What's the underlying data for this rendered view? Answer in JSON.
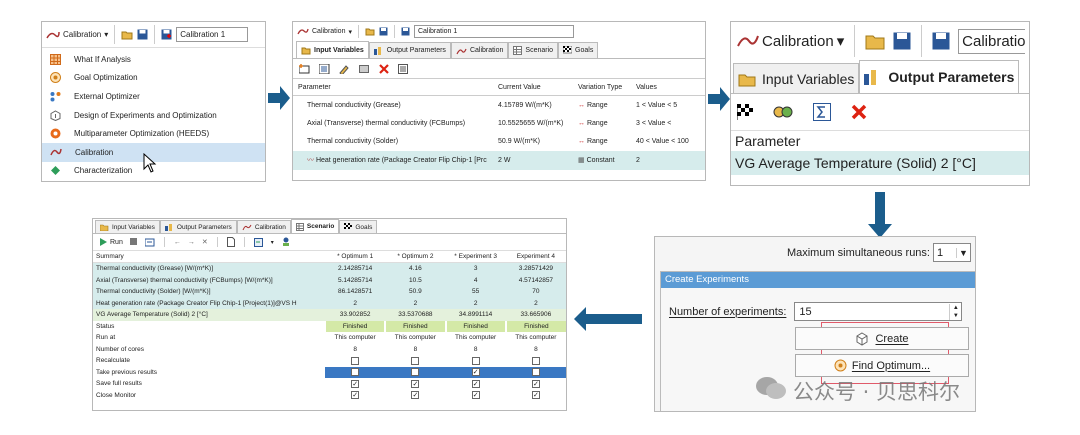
{
  "toolbar": {
    "calibration_label": "Calibration",
    "calibration_field": "Calibration 1"
  },
  "menu": {
    "items": [
      {
        "label": "What If Analysis",
        "icon": "grid-icon"
      },
      {
        "label": "Goal Optimization",
        "icon": "target-icon"
      },
      {
        "label": "External Optimizer",
        "icon": "nodes-icon"
      },
      {
        "label": "Design of Experiments and Optimization",
        "icon": "doe-icon"
      },
      {
        "label": "Multiparameter Optimization (HEEDS)",
        "icon": "heeds-icon"
      },
      {
        "label": "Calibration",
        "icon": "calibration-icon"
      },
      {
        "label": "Characterization",
        "icon": "characterization-icon"
      }
    ]
  },
  "tabs": {
    "input_variables": "Input Variables",
    "output_parameters": "Output Parameters",
    "calibration": "Calibration",
    "scenario": "Scenario",
    "goals": "Goals"
  },
  "variables_table": {
    "headers": [
      "Parameter",
      "Current Value",
      "Variation Type",
      "Values"
    ],
    "rows": [
      {
        "param": "Thermal conductivity (Grease)",
        "value": "4.15789 W/(m*K)",
        "type": "Range",
        "values": "1 < Value < 5"
      },
      {
        "param": "Axial (Transverse) thermal conductivity (FCBumps)",
        "value": "10.5525655 W/(m*K)",
        "type": "Range",
        "values": "3 < Value <"
      },
      {
        "param": "Thermal conductivity (Solder)",
        "value": "50.9 W/(m*K)",
        "type": "Range",
        "values": "40 < Value < 100"
      },
      {
        "param": "Heat generation rate (Package Creator Flip Chip-1 [Prc",
        "value": "2 W",
        "type": "Constant",
        "values": "2"
      }
    ]
  },
  "output_panel": {
    "header": "Parameter",
    "row": "VG Average Temperature (Solid) 2 [°C]"
  },
  "scenario_toolbar": {
    "run_label": "Run"
  },
  "scenario_table": {
    "headers": [
      "Summary",
      "* Optimum 1",
      "* Optimum 2",
      "* Experiment 3",
      "Experiment 4"
    ],
    "value_rows": [
      {
        "label": "Thermal conductivity (Grease) [W/(m*K)]",
        "vals": [
          "2.14285714",
          "4.16",
          "3",
          "3.28571429"
        ]
      },
      {
        "label": "Axial (Transverse) thermal conductivity (FCBumps) [W/(m*K)]",
        "vals": [
          "5.14285714",
          "10.5",
          "4",
          "4.57142857"
        ]
      },
      {
        "label": "Thermal conductivity (Solder) [W/(m*K)]",
        "vals": [
          "86.1428571",
          "50.9",
          "55",
          "70"
        ]
      },
      {
        "label": "Heat generation rate (Package Creator Flip Chip-1 [Project(1)]@VS H",
        "vals": [
          "2",
          "2",
          "2",
          "2"
        ]
      },
      {
        "label": "VG Average Temperature (Solid) 2 [°C]",
        "vals": [
          "33.902852",
          "33.5370688",
          "34.8991114",
          "33.665906"
        ]
      }
    ],
    "status_label": "Status",
    "status_vals": [
      "Finished",
      "Finished",
      "Finished",
      "Finished"
    ],
    "run_at_label": "Run at",
    "run_at_vals": [
      "This computer",
      "This computer",
      "This computer",
      "This computer"
    ],
    "cores_label": "Number of cores",
    "cores_vals": [
      "8",
      "8",
      "8",
      "8"
    ],
    "check_rows": [
      {
        "label": "Recalculate",
        "checks": [
          false,
          false,
          false,
          false
        ],
        "highlight": false
      },
      {
        "label": "Take previous results",
        "checks": [
          false,
          false,
          true,
          false
        ],
        "highlight": true
      },
      {
        "label": "Save full results",
        "checks": [
          true,
          true,
          true,
          true
        ],
        "highlight": false
      },
      {
        "label": "Close Monitor",
        "checks": [
          true,
          true,
          true,
          true
        ],
        "highlight": false
      }
    ]
  },
  "experiments_panel": {
    "max_runs_label": "Maximum simultaneous runs:",
    "max_runs_value": "1",
    "section_title": "Create Experiments",
    "num_label": "Number of experiments:",
    "num_value": "15",
    "create_label": "Create",
    "find_label": "Find Optimum..."
  },
  "watermark": "公众号 · 贝思科尔",
  "colors": {
    "arrow": "#1b5d8c",
    "selected": "#cfe2f3",
    "row_highlight": "#d6ecec",
    "status_green": "#d4e9a7",
    "check_blue": "#3a78c3",
    "section_blue": "#5b9bd5"
  }
}
